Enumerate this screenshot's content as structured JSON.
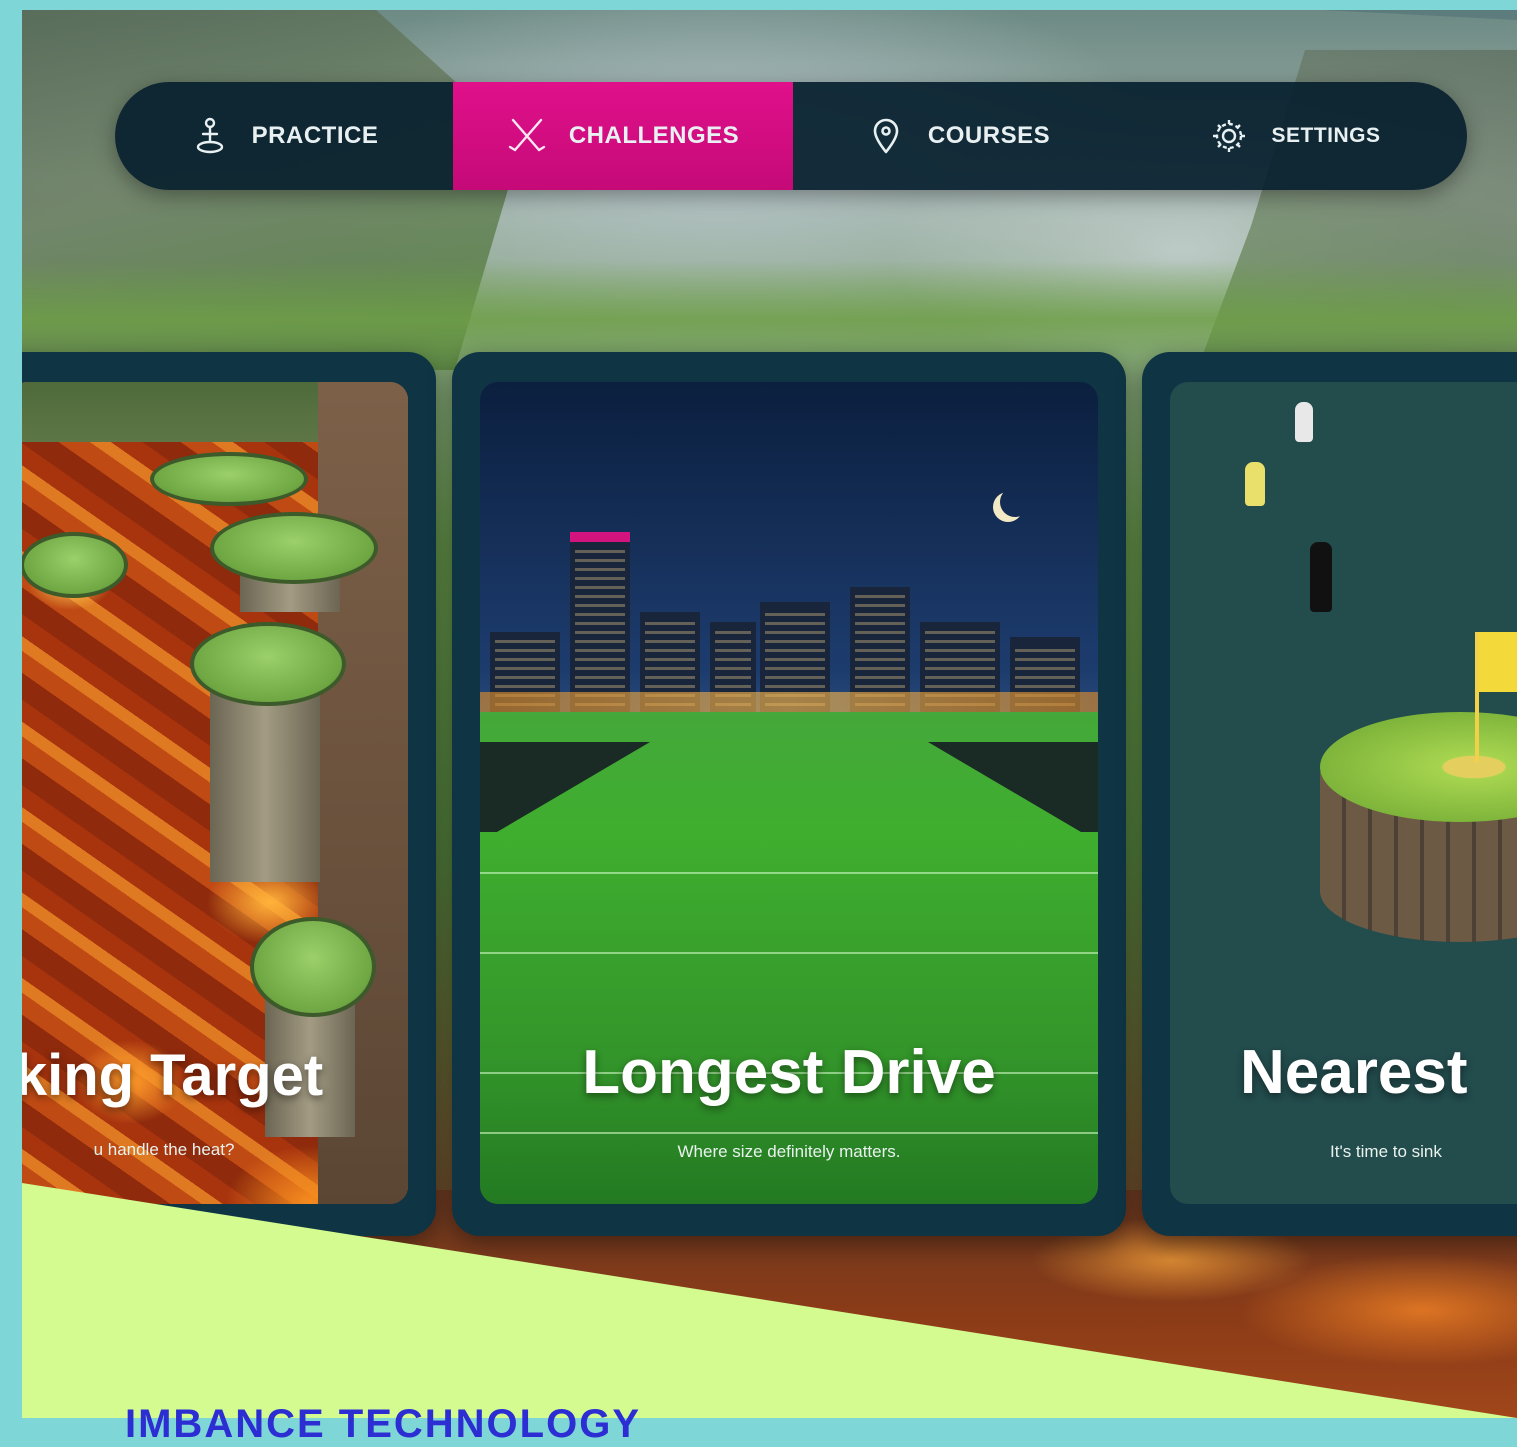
{
  "nav": {
    "items": [
      {
        "label": "PRACTICE",
        "icon": "golfer-tee-icon"
      },
      {
        "label": "CHALLENGES",
        "icon": "crossed-clubs-icon",
        "active": true
      },
      {
        "label": "COURSES",
        "icon": "location-pin-icon"
      },
      {
        "label": "SETTINGS",
        "icon": "gear-icon"
      }
    ],
    "active_color": "#d90d84",
    "bar_color": "#06202e"
  },
  "cards": [
    {
      "title": "king Target",
      "subtitle": "u handle the heat?"
    },
    {
      "title": "Longest Drive",
      "subtitle": "Where size definitely matters."
    },
    {
      "title": "Nearest",
      "subtitle": "It's time to sink"
    }
  ],
  "banner": {
    "text": "IMBANCE TECHNOLOGY",
    "bg_color": "#d3fb8f",
    "text_color": "#2c2dd3"
  }
}
